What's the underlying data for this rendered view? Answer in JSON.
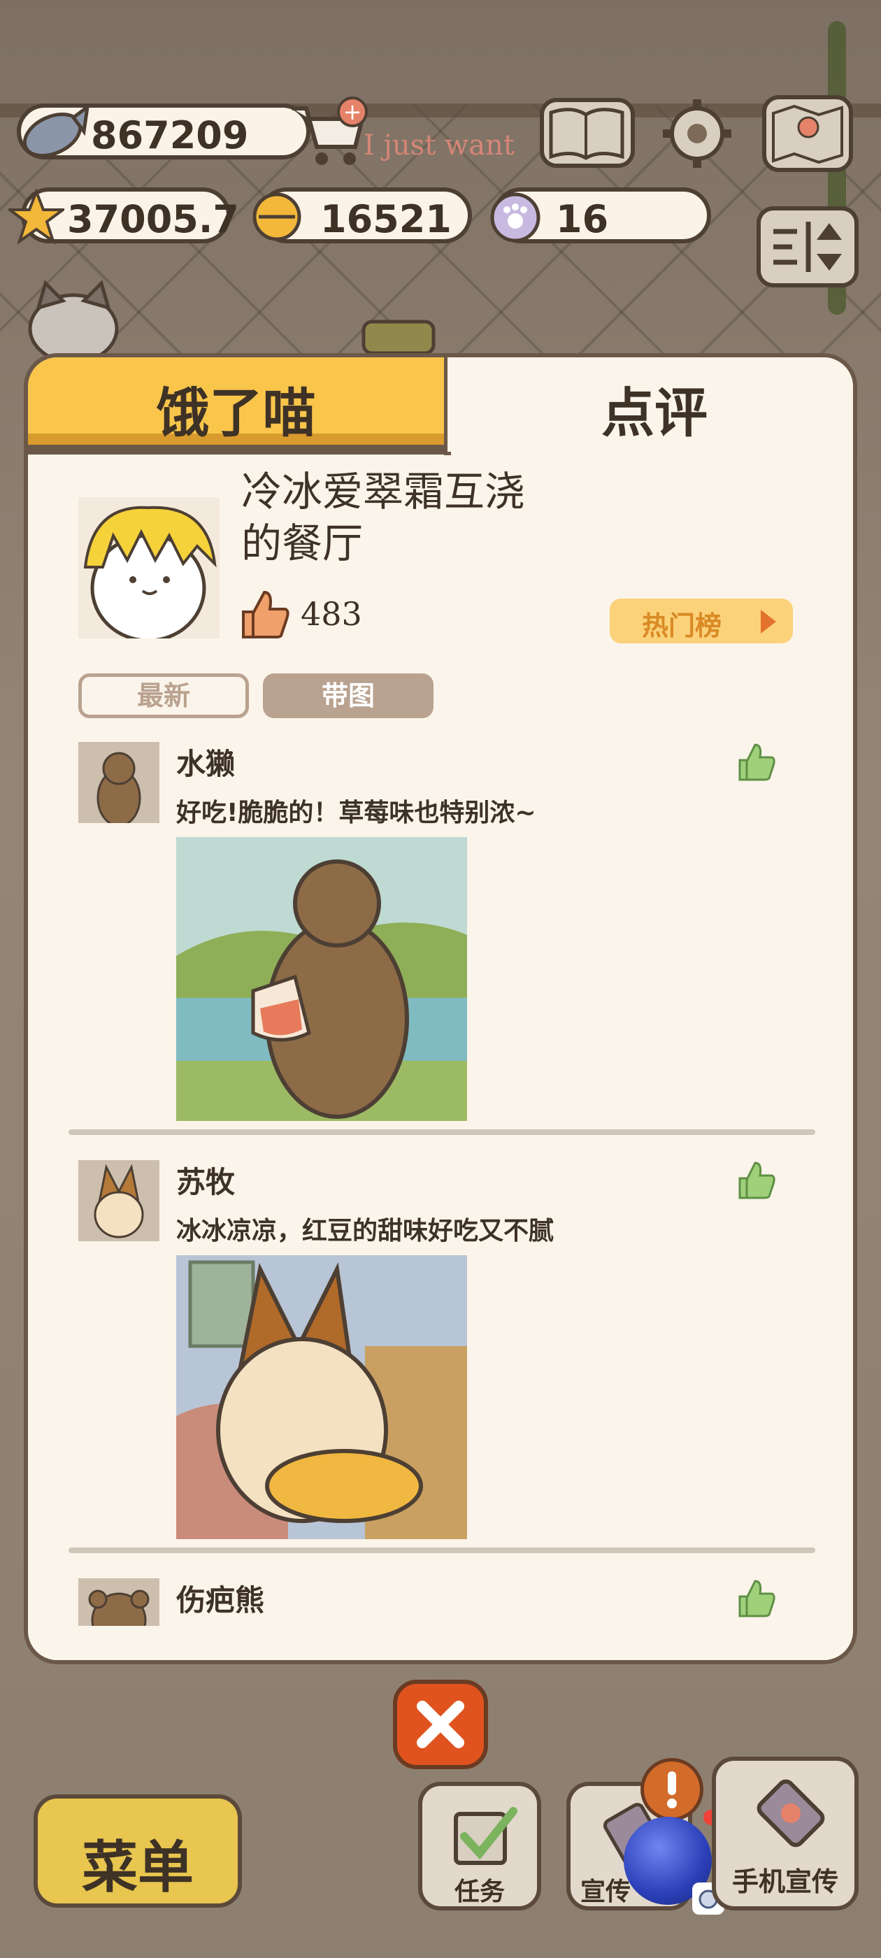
{
  "currency": {
    "fish": "867209",
    "star": "37005.7",
    "bell": "16521",
    "paw": "16"
  },
  "overlay_text": "I just want",
  "tabs": {
    "left": "饿了喵",
    "right": "点评"
  },
  "restaurant": {
    "name_line1": "冷冰爱翠霜互浇",
    "name_line2": "的餐厅",
    "likes": "483",
    "hot_label": "热门榜"
  },
  "filters": {
    "latest": "最新",
    "with_photo": "带图"
  },
  "reviews": [
    {
      "name": "水獭",
      "text": "好吃!脆脆的！草莓味也特别浓~"
    },
    {
      "name": "苏牧",
      "text": "冰冰凉凉，红豆的甜味好吃又不腻"
    },
    {
      "name": "伤疤熊",
      "text": ""
    }
  ],
  "bottom": {
    "menu": "菜单",
    "tasks": "任务",
    "promo": "宣传",
    "phone_promo": "手机宣传"
  },
  "colors": {
    "tab_active": "#f9c54b",
    "panel_bg": "#fbf4ea",
    "like_green": "#7bb35e",
    "close_orange": "#e0531f"
  }
}
